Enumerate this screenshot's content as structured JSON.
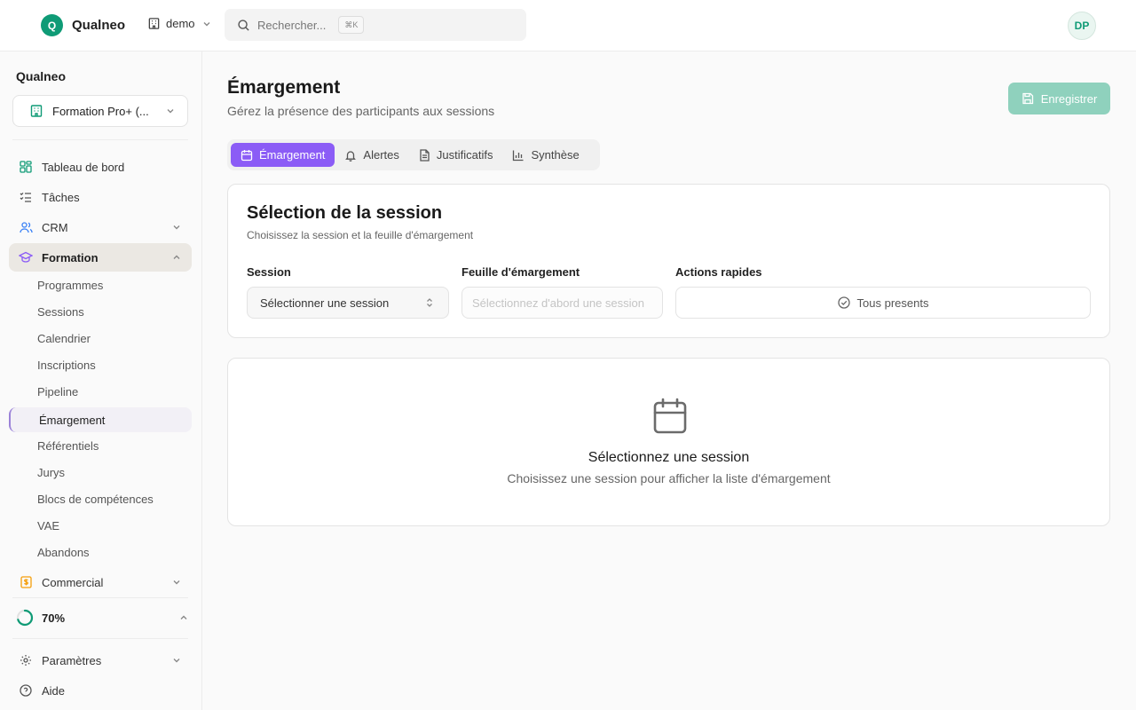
{
  "header": {
    "brand_letter": "Q",
    "brand_name": "Qualneo",
    "org_label": "demo",
    "search_placeholder": "Rechercher...",
    "search_shortcut": "⌘K",
    "avatar_initials": "DP"
  },
  "sidebar": {
    "title": "Qualneo",
    "org_select": "Formation Pro+ (...",
    "items": [
      {
        "label": "Tableau de bord",
        "icon": "dashboard-icon"
      },
      {
        "label": "Tâches",
        "icon": "tasks-icon"
      },
      {
        "label": "CRM",
        "icon": "users-icon"
      },
      {
        "label": "Formation",
        "icon": "graduation-cap-icon"
      }
    ],
    "formation_sub": [
      "Programmes",
      "Sessions",
      "Calendrier",
      "Inscriptions",
      "Pipeline",
      "Émargement",
      "Référentiels",
      "Jurys",
      "Blocs de compétences",
      "VAE",
      "Abandons"
    ],
    "commercial_label": "Commercial",
    "progress_label": "70%",
    "progress_value": 0.7,
    "settings_label": "Paramètres",
    "help_label": "Aide"
  },
  "main": {
    "title": "Émargement",
    "subtitle": "Gérez la présence des participants aux sessions",
    "save_label": "Enregistrer",
    "tabs": [
      {
        "label": "Émargement",
        "icon": "calendar-icon"
      },
      {
        "label": "Alertes",
        "icon": "bell-icon"
      },
      {
        "label": "Justificatifs",
        "icon": "document-icon"
      },
      {
        "label": "Synthèse",
        "icon": "bar-chart-icon"
      }
    ],
    "selection": {
      "title": "Sélection de la session",
      "subtitle": "Choisissez la session et la feuille d'émargement",
      "session_label": "Session",
      "session_value": "Sélectionner une session",
      "sheet_label": "Feuille d'émargement",
      "sheet_placeholder": "Sélectionnez d'abord une session",
      "actions_label": "Actions rapides",
      "all_present_label": "Tous presents"
    },
    "empty": {
      "title": "Sélectionnez une session",
      "subtitle": "Choisissez une session pour afficher la liste d'émargement"
    }
  },
  "colors": {
    "brand": "#0f9b76",
    "accent": "#8b5cf6",
    "save_button": "#8fd1bd"
  }
}
